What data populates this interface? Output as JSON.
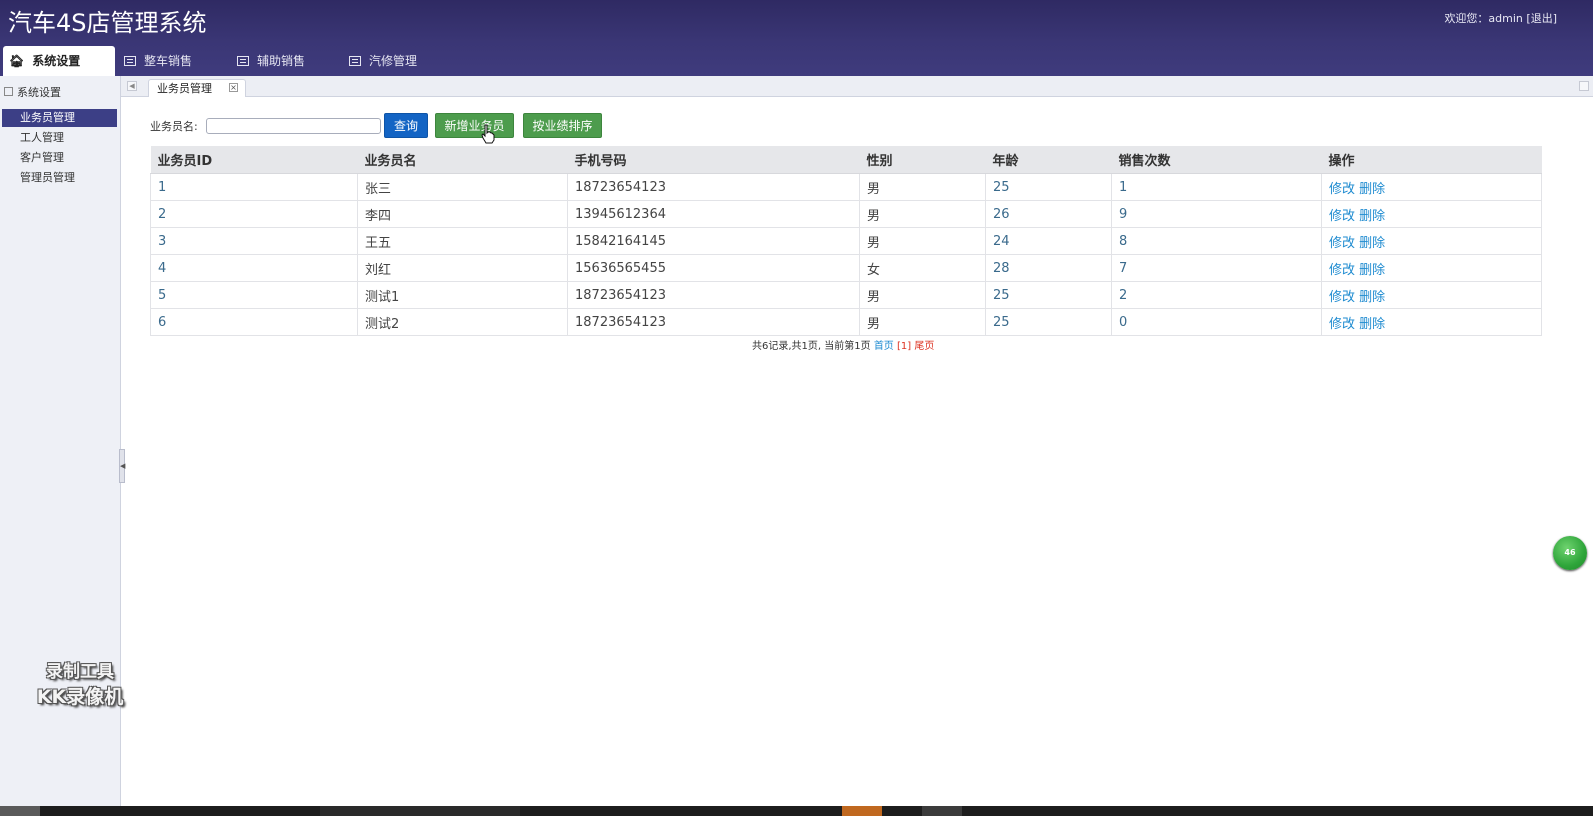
{
  "app": {
    "title": "汽车4S店管理系统",
    "welcome_text": "欢迎您：admin",
    "logout_label": "[退出]"
  },
  "topnav": {
    "items": [
      {
        "label": "系统设置",
        "icon": "home-icon",
        "active": true
      },
      {
        "label": "整车销售",
        "icon": "list-icon",
        "active": false
      },
      {
        "label": "辅助销售",
        "icon": "list-icon",
        "active": false
      },
      {
        "label": "汽修管理",
        "icon": "list-icon",
        "active": false
      }
    ]
  },
  "sidebar": {
    "header": "系统设置",
    "items": [
      {
        "label": "业务员管理",
        "active": true
      },
      {
        "label": "工人管理",
        "active": false
      },
      {
        "label": "客户管理",
        "active": false
      },
      {
        "label": "管理员管理",
        "active": false
      }
    ]
  },
  "content_tab": {
    "label": "业务员管理",
    "close_icon": "close-icon"
  },
  "search": {
    "label": "业务员名:",
    "value": "",
    "placeholder": "",
    "query_button": "查询",
    "add_button": "新增业务员",
    "sort_button": "按业绩排序"
  },
  "table": {
    "headers": [
      "业务员ID",
      "业务员名",
      "手机号码",
      "性别",
      "年龄",
      "销售次数",
      "操作"
    ],
    "rows": [
      {
        "id": "1",
        "name": "张三",
        "phone": "18723654123",
        "gender": "男",
        "age": "25",
        "sales": "1",
        "edit": "修改",
        "delete": "删除"
      },
      {
        "id": "2",
        "name": "李四",
        "phone": "13945612364",
        "gender": "男",
        "age": "26",
        "sales": "9",
        "edit": "修改",
        "delete": "删除"
      },
      {
        "id": "3",
        "name": "王五",
        "phone": "15842164145",
        "gender": "男",
        "age": "24",
        "sales": "8",
        "edit": "修改",
        "delete": "删除"
      },
      {
        "id": "4",
        "name": "刘红",
        "phone": "15636565455",
        "gender": "女",
        "age": "28",
        "sales": "7",
        "edit": "修改",
        "delete": "删除"
      },
      {
        "id": "5",
        "name": "测试1",
        "phone": "18723654123",
        "gender": "男",
        "age": "25",
        "sales": "2",
        "edit": "修改",
        "delete": "删除"
      },
      {
        "id": "6",
        "name": "测试2",
        "phone": "18723654123",
        "gender": "男",
        "age": "25",
        "sales": "0",
        "edit": "修改",
        "delete": "删除"
      }
    ]
  },
  "pager": {
    "summary": "共6记录,共1页, 当前第1页",
    "first": "首页",
    "current": "[1]",
    "last": "尾页"
  },
  "watermark": {
    "line1": "录制工具",
    "line2": "KK录像机"
  },
  "float_badge": "46"
}
